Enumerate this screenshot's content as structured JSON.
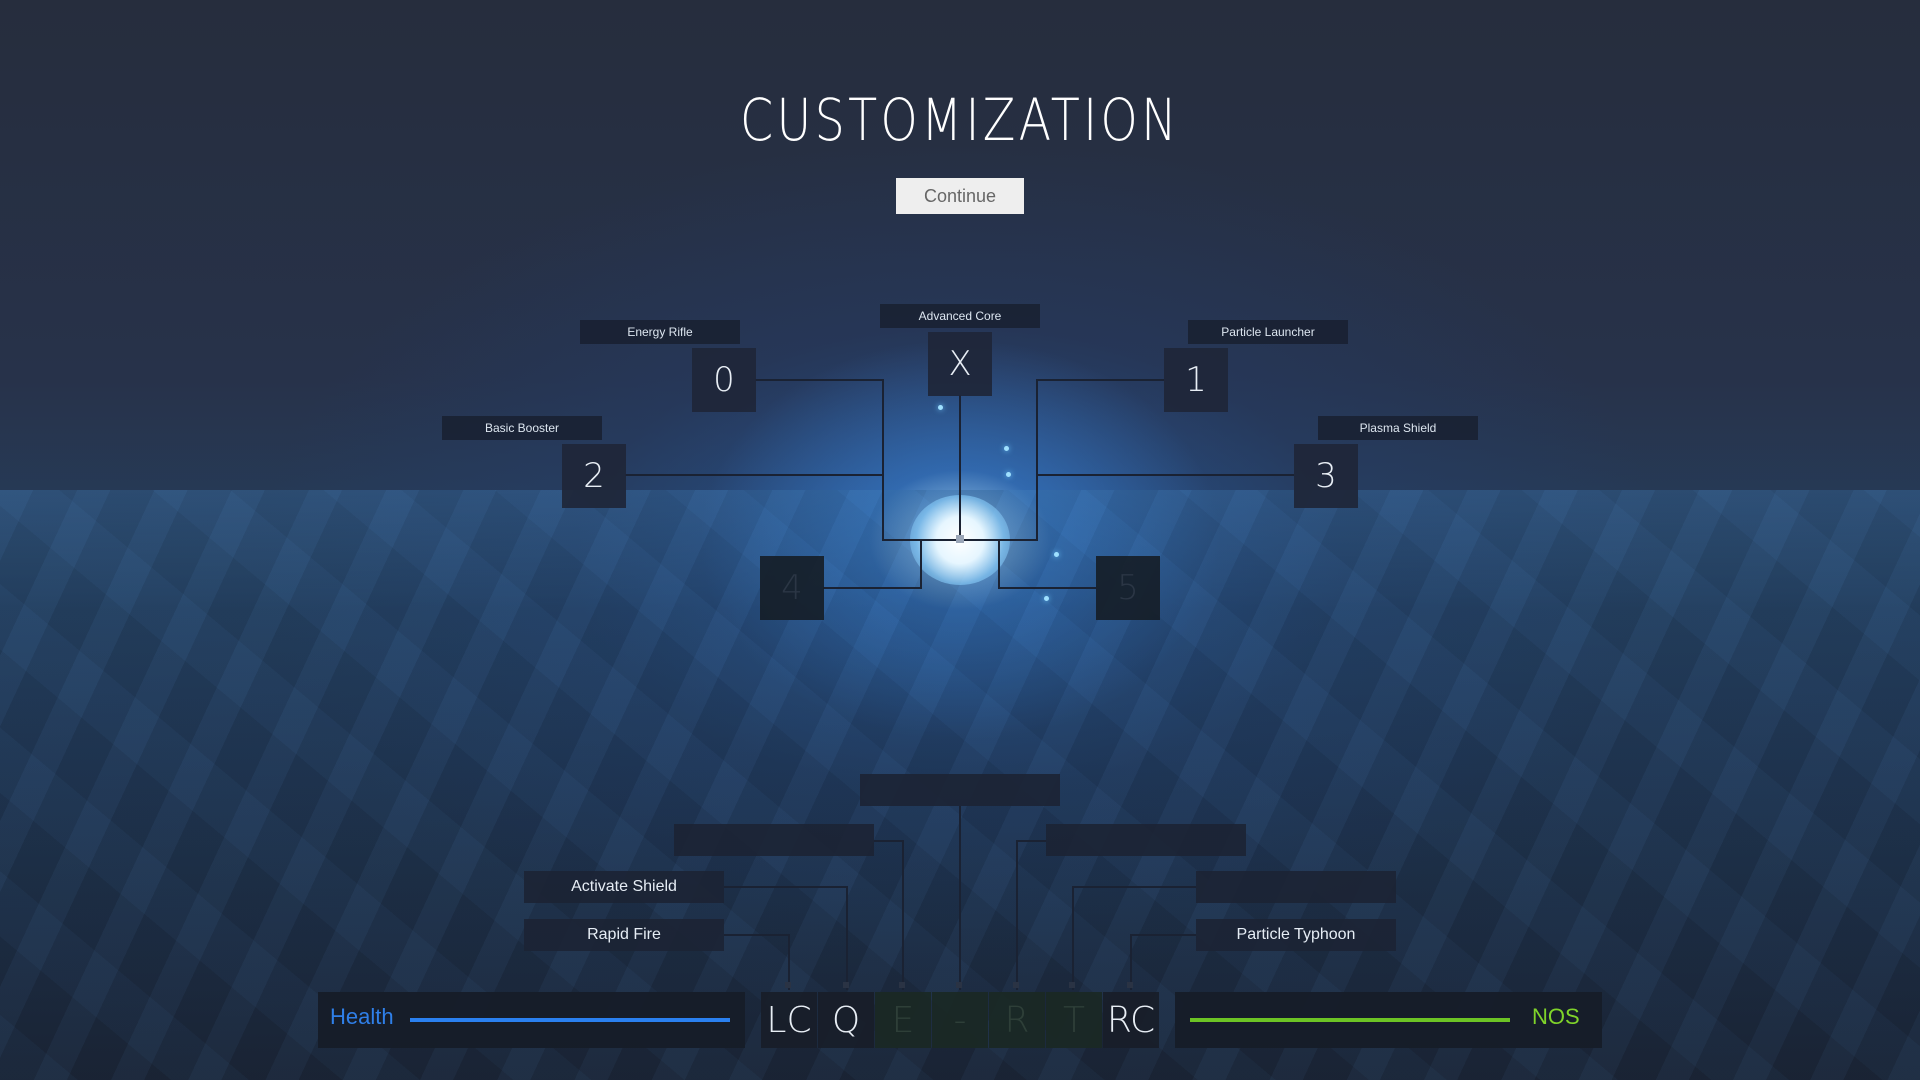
{
  "screen": {
    "title": "CUSTOMIZATION",
    "continue_label": "Continue"
  },
  "slots": [
    {
      "key": "X",
      "label": "Advanced Core"
    },
    {
      "key": "0",
      "label": "Energy Rifle"
    },
    {
      "key": "1",
      "label": "Particle Launcher"
    },
    {
      "key": "2",
      "label": "Basic Booster"
    },
    {
      "key": "3",
      "label": "Plasma Shield"
    },
    {
      "key": "4",
      "label": ""
    },
    {
      "key": "5",
      "label": ""
    }
  ],
  "abilities": {
    "top_center": "",
    "left_upper": "",
    "right_upper": "",
    "activate_shield": "Activate Shield",
    "rapid_fire": "Rapid Fire",
    "right_mid": "",
    "particle_typhoon": "Particle Typhoon"
  },
  "hud": {
    "health_label": "Health",
    "health_level": 1.0,
    "health_color": "#2a80f0",
    "nos_label": "NOS",
    "nos_level": 1.0,
    "nos_color": "#6cc425",
    "hotkeys": [
      "LC",
      "Q",
      "E",
      "-",
      "R",
      "T",
      "RC"
    ]
  }
}
